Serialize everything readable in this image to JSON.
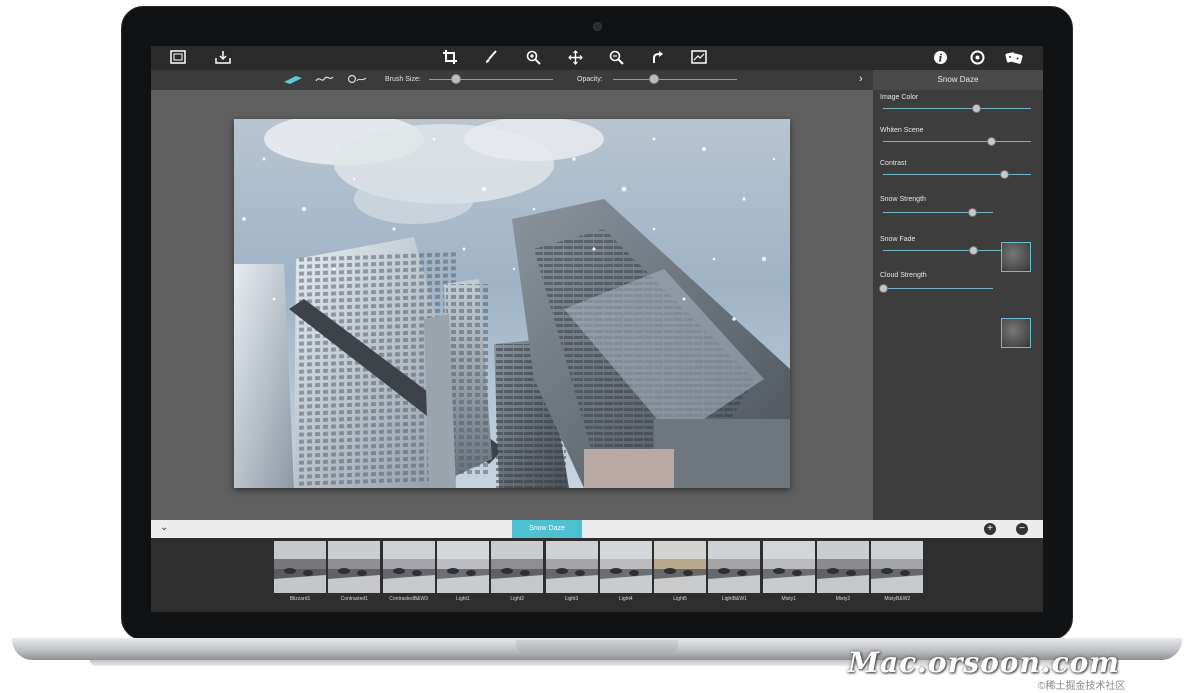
{
  "toolbar": {
    "left_icons": [
      "gallery-icon",
      "import-icon"
    ],
    "center_icons": [
      "crop-icon",
      "brush-icon",
      "zoom-in-icon",
      "move-icon",
      "zoom-out-icon",
      "redo-icon",
      "compare-icon"
    ],
    "right_icons": [
      "info-icon",
      "settings-icon",
      "random-icon"
    ]
  },
  "subbar": {
    "brush_size_label": "Brush Size:",
    "brush_size_value": 0.22,
    "opacity_label": "Opacity:",
    "opacity_value": 0.33
  },
  "panel": {
    "title": "Snow Daze",
    "sliders": [
      {
        "label": "Image Color",
        "value": 0.63
      },
      {
        "label": "Whiten Scene",
        "value": 0.73
      },
      {
        "label": "Contrast",
        "value": 0.82
      },
      {
        "label": "Snow Strength",
        "value": 0.81
      },
      {
        "label": "Snow Fade",
        "value": 0.61
      },
      {
        "label": "Cloud Strength",
        "value": 0.0
      }
    ]
  },
  "bottom": {
    "active_preset": "Snow Daze",
    "add_label": "+",
    "remove_label": "−"
  },
  "presets": [
    "Blizzard1",
    "Contrasted1",
    "ContrastedB&W3",
    "Light1",
    "Light2",
    "Light3",
    "Light4",
    "Light5",
    "LightB&W1",
    "Misty1",
    "Misty2",
    "MistyB&W2"
  ],
  "watermark": "Mac.orsoon.com",
  "watermark_sub": "©稀土掘金技术社区",
  "colors": {
    "accent": "#4fc0d0"
  }
}
